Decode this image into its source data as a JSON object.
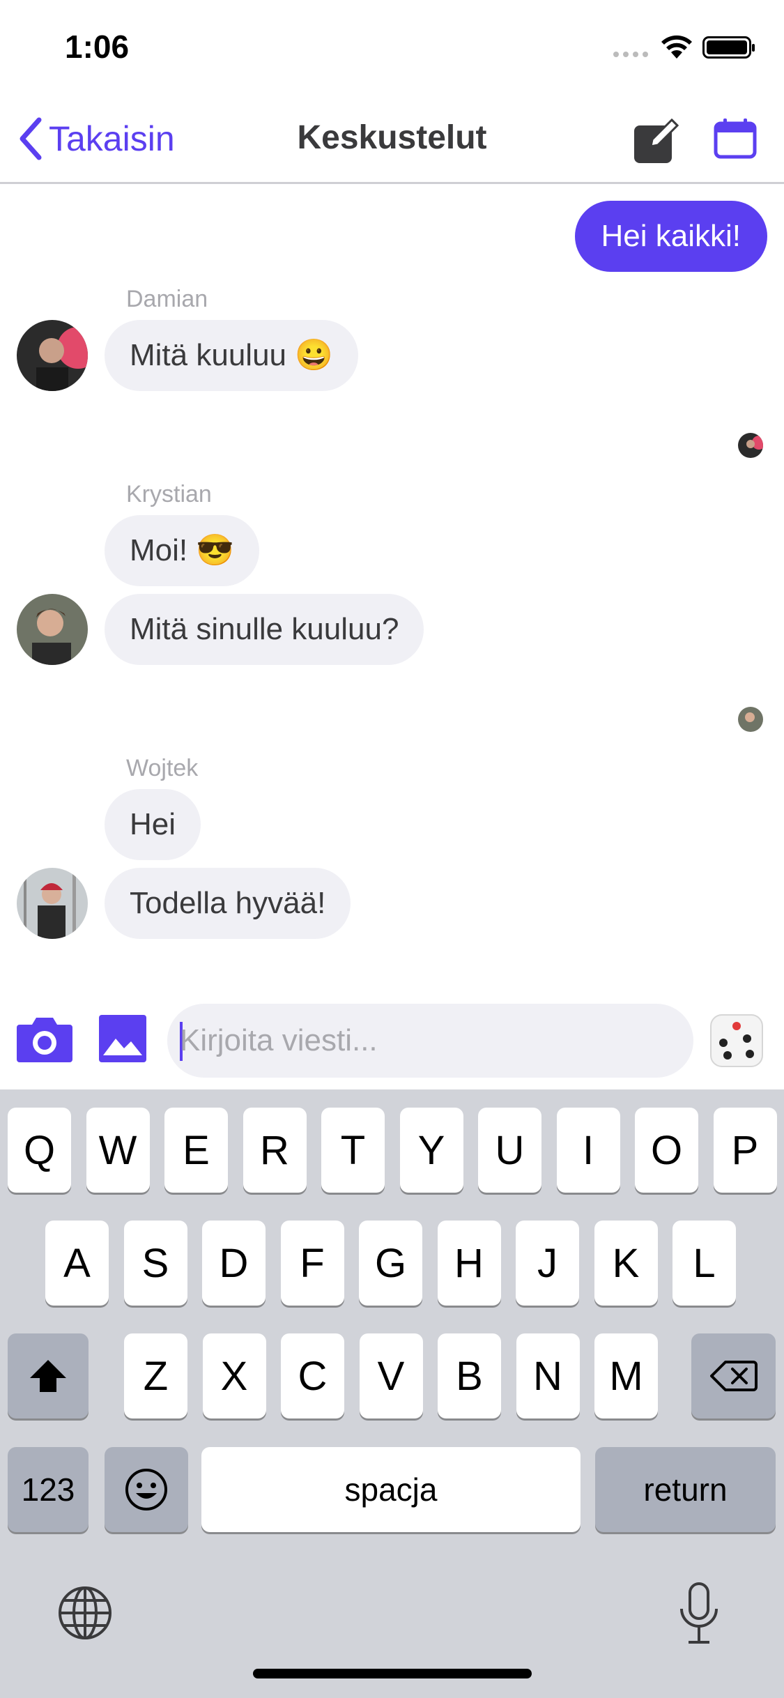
{
  "status_bar": {
    "time": "1:06"
  },
  "nav": {
    "back_label": "Takaisin",
    "title": "Keskustelut"
  },
  "colors": {
    "accent": "#5b3ff0",
    "bubble_in": "#f0f0f5",
    "keyboard_bg": "#d1d3d9"
  },
  "chat": {
    "outgoing": [
      {
        "text": "Hei kaikki!"
      }
    ],
    "groups": [
      {
        "sender": "Damian",
        "messages": [
          "Mitä kuuluu 😀"
        ]
      },
      {
        "sender": "Krystian",
        "messages": [
          "Moi! 😎",
          "Mitä sinulle kuuluu?"
        ]
      },
      {
        "sender": "Wojtek",
        "messages": [
          "Hei",
          "Todella hyvää!"
        ]
      }
    ]
  },
  "composer": {
    "placeholder": "Kirjoita viesti..."
  },
  "keyboard": {
    "row1": [
      "Q",
      "W",
      "E",
      "R",
      "T",
      "Y",
      "U",
      "I",
      "O",
      "P"
    ],
    "row2": [
      "A",
      "S",
      "D",
      "F",
      "G",
      "H",
      "J",
      "K",
      "L"
    ],
    "row3": [
      "Z",
      "X",
      "C",
      "V",
      "B",
      "N",
      "M"
    ],
    "numbers_label": "123",
    "space_label": "spacja",
    "return_label": "return"
  },
  "icons": [
    "back-chevron-icon",
    "compose-icon",
    "calendar-icon",
    "camera-icon",
    "image-icon",
    "dice-icon",
    "shift-icon",
    "backspace-icon",
    "emoji-icon",
    "globe-icon",
    "microphone-icon"
  ]
}
